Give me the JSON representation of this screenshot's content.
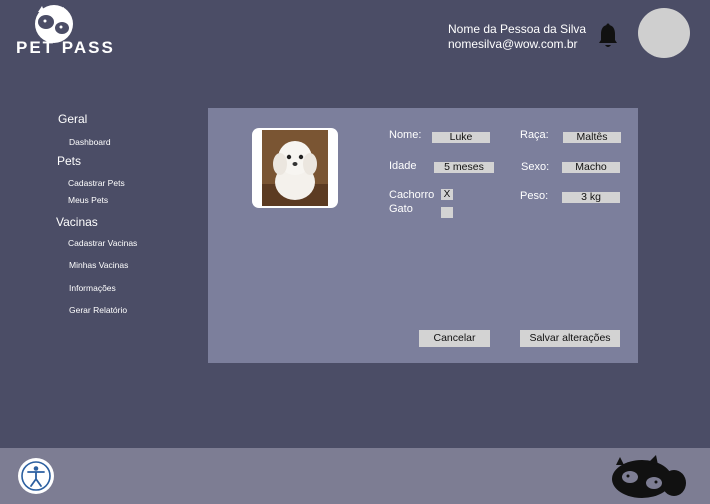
{
  "brand": {
    "logo_text": "PET PASS"
  },
  "user": {
    "name": "Nome da Pessoa da Silva",
    "email": "nomesilva@wow.com.br"
  },
  "sidebar": {
    "groups": [
      {
        "label": "Geral",
        "items": [
          "Dashboard"
        ]
      },
      {
        "label": "Pets",
        "items": [
          "Cadastrar Pets",
          "Meus Pets"
        ]
      },
      {
        "label": "Vacinas",
        "items": [
          "Cadastrar Vacinas",
          "Minhas Vacinas",
          "Informações",
          "Gerar Relatório"
        ]
      }
    ]
  },
  "form": {
    "nome_label": "Nome:",
    "nome_value": "Luke",
    "raca_label": "Raça:",
    "raca_value": "Maltês",
    "idade_label": "Idade",
    "idade_value": "5 meses",
    "sexo_label": "Sexo:",
    "sexo_value": "Macho",
    "cachorro_label": "Cachorro",
    "cachorro_value": "X",
    "gato_label": "Gato",
    "gato_value": "",
    "peso_label": "Peso:",
    "peso_value": "3 kg"
  },
  "buttons": {
    "cancel": "Cancelar",
    "save": "Salvar alterações"
  },
  "icons": {
    "bell": "bell-icon",
    "accessibility": "accessibility-icon",
    "logo": "cat-dog-logo-icon"
  }
}
